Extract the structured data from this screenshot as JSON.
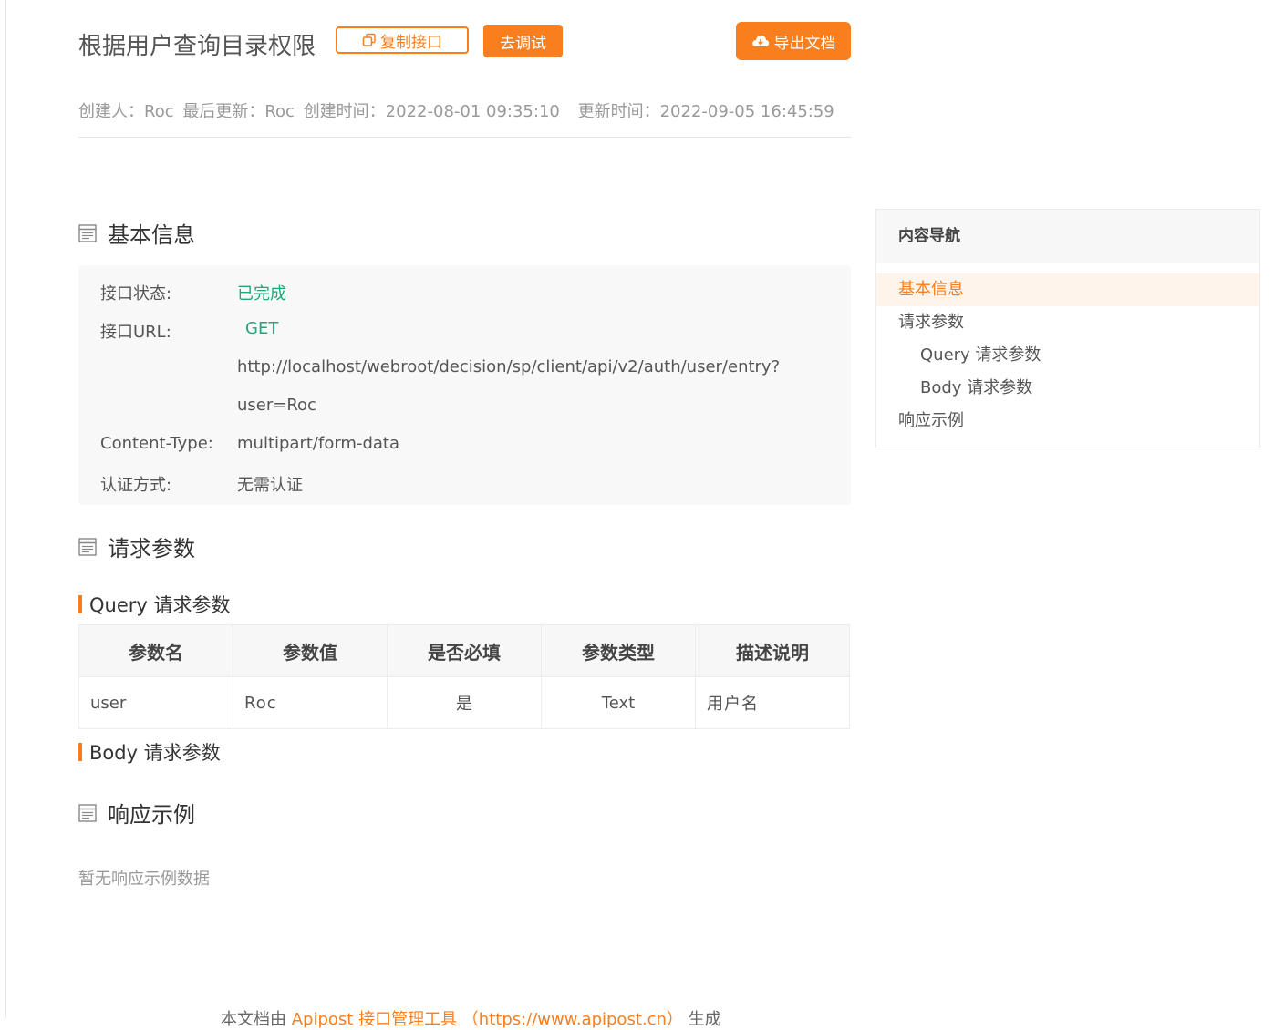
{
  "header": {
    "title": "根据用户查询目录权限",
    "copy_label": "复制接口",
    "debug_label": "去调试",
    "export_label": "导出文档"
  },
  "meta": {
    "creator": "创建人：Roc",
    "updater": "最后更新：Roc",
    "created": "创建时间：2022-08-01 09:35:10",
    "updated": "更新时间：2022-09-05 16:45:59"
  },
  "basic": {
    "heading": "基本信息",
    "status_label": "接口状态:",
    "status_value": "已完成",
    "url_label": "接口URL:",
    "method": "GET",
    "url_line1": "http://localhost/webroot/decision/sp/client/api/v2/auth/user/entry?",
    "url_line2": "user=Roc",
    "ctype_label": "Content-Type:",
    "ctype_value": "multipart/form-data",
    "auth_label": "认证方式:",
    "auth_value": "无需认证"
  },
  "request": {
    "heading": "请求参数",
    "query_heading": "Query 请求参数",
    "columns": [
      "参数名",
      "参数值",
      "是否必填",
      "参数类型",
      "描述说明"
    ],
    "rows": [
      [
        "user",
        "Roc",
        "是",
        "Text",
        "用户名"
      ]
    ],
    "body_heading": "Body 请求参数"
  },
  "response": {
    "heading": "响应示例",
    "empty": "暂无响应示例数据"
  },
  "footer": {
    "prefix": "本文档由",
    "link": "Apipost 接口管理工具 （https://www.apipost.cn）",
    "suffix": "生成"
  },
  "nav": {
    "title": "内容导航",
    "items": [
      "基本信息",
      "请求参数",
      "Query 请求参数",
      "Body 请求参数",
      "响应示例"
    ]
  },
  "colors": {
    "accent": "#f97f1e",
    "success": "#22a779"
  }
}
